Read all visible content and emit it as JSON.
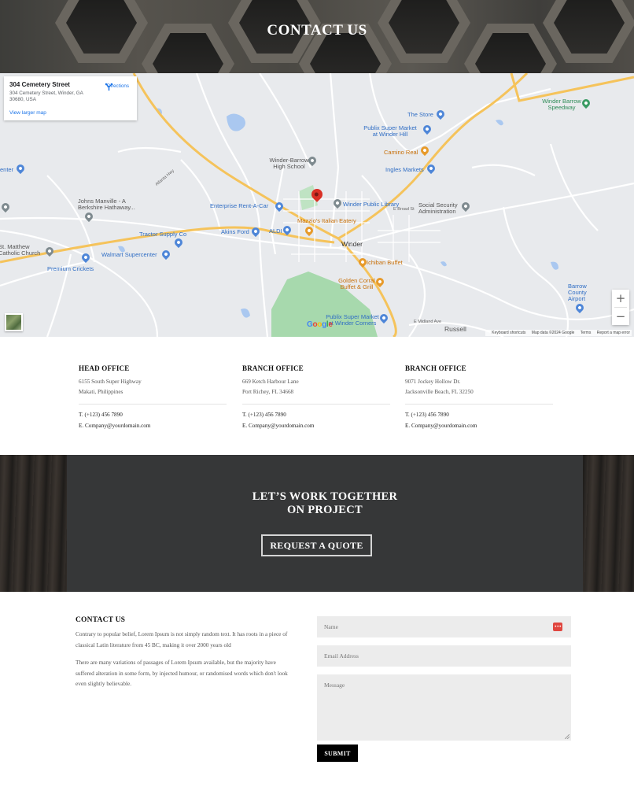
{
  "hero": {
    "title": "CONTACT US"
  },
  "map": {
    "info_card": {
      "title": "304 Cemetery Street",
      "address": "304 Cemetery Street, Winder, GA 30680, USA",
      "directions_label": "Directions",
      "larger_map_label": "View larger map"
    },
    "labels": {
      "the_store": "The Store",
      "publix_winder_hill": "Publix Super Market at Winder Hill",
      "camino_real": "Camino Real",
      "ingles": "Ingles Markets",
      "winder_barrow_speedway": "Winder Barrow Speedway",
      "winder_barrow_high": "Winder-Barrow High School",
      "johns_manville": "Johns Manville - A Berkshire Hathaway...",
      "enterprise": "Enterprise Rent-A-Car",
      "winder_public_library": "Winder Public Library",
      "social_security": "Social Security Administration",
      "mazzios": "Mazzio's Italian Eatery",
      "tractor_supply": "Tractor Supply Co",
      "akins_ford": "Akins Ford",
      "aldi": "ALDI",
      "winder": "Winder",
      "st_matthew": "St. Matthew Catholic Church",
      "walmart": "Walmart Supercenter",
      "ichiban": "Ichiban Buffet",
      "premium_crickets": "Premium Crickets",
      "golden_corral": "Golden Corral Buffet & Grill",
      "publix_winder_corners": "Publix Super Market at Winder Corners",
      "barrow_airport": "Barrow County Airport",
      "russell": "Russell",
      "center": "enter",
      "broad_st": "E Broad St",
      "midland_ave": "E Midland Ave",
      "atlanta_hwy": "Atlanta Hwy"
    },
    "zoom_in": "+",
    "zoom_out": "−",
    "google_logo": "Google",
    "attribution": {
      "shortcuts": "Keyboard shortcuts",
      "data": "Map data ©2024 Google",
      "terms": "Terms",
      "report": "Report a map error"
    }
  },
  "offices": [
    {
      "title": "HEAD OFFICE",
      "address_line1": "6155 South Super Highway",
      "address_line2": "Makati, Philippines",
      "phone": "T. (+123) 456 7890",
      "email": "E. Company@yourdomain.com"
    },
    {
      "title": "BRANCH OFFICE",
      "address_line1": "669 Ketch Harbour Lane",
      "address_line2": "Port Richey, FL 34668",
      "phone": "T. (+123) 456 7890",
      "email": "E. Company@yourdomain.com"
    },
    {
      "title": "BRANCH OFFICE",
      "address_line1": "9071 Jockey Hollow Dr.",
      "address_line2": "Jacksonville Beach, FL 32250",
      "phone": "T. (+123) 456 7890",
      "email": "E. Company@yourdomain.com"
    }
  ],
  "cta": {
    "title_line1": "LET’S WORK TOGETHER",
    "title_line2": "ON PROJECT",
    "button_label": "REQUEST A QUOTE"
  },
  "contact": {
    "title": "CONTACT US",
    "paragraph1": "Contrary to popular belief, Lorem Ipsum is not simply random text. It has roots in a piece of classical Latin literature from 45 BC, making it over 2000 years old",
    "paragraph2": "There are many variations of passages of Lorem Ipsum available, but the majority have suffered alteration in some form, by injected humour, or randomised words which don't look even slightly believable."
  },
  "form": {
    "name_placeholder": "Name",
    "email_placeholder": "Email Address",
    "message_placeholder": "Message",
    "password_manager_icon": "•••",
    "submit_label": "SUBMIT"
  },
  "colors": {
    "map_pin": "#d93025",
    "poi_blue": "#4e86d8",
    "poi_orange": "#e79a2a",
    "cta_panel": "#363738",
    "submit_bg": "#000000",
    "field_bg": "#ececec"
  }
}
